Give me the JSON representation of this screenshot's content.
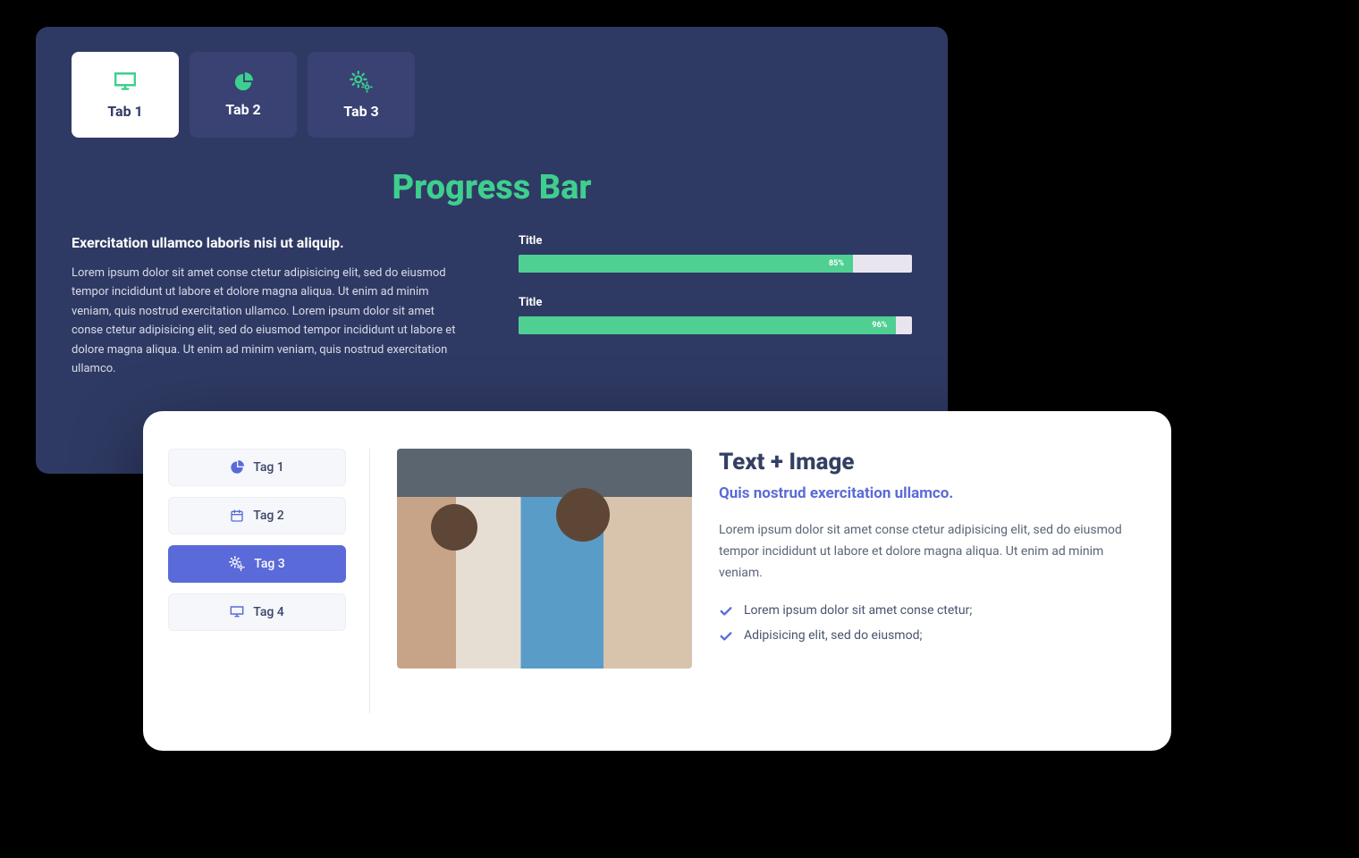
{
  "top": {
    "tabs": [
      {
        "label": "Tab 1",
        "icon": "desktop-icon",
        "active": true
      },
      {
        "label": "Tab 2",
        "icon": "pie-chart-icon",
        "active": false
      },
      {
        "label": "Tab 3",
        "icon": "gears-icon",
        "active": false
      }
    ],
    "section_title": "Progress Bar",
    "lead": "Exercitation ullamco laboris nisi ut aliquip.",
    "body": "Lorem ipsum dolor sit amet conse ctetur adipisicing elit, sed do eiusmod tempor incididunt ut labore et dolore magna aliqua. Ut enim ad minim veniam, quis nostrud exercitation ullamco. Lorem ipsum dolor sit amet conse ctetur adipisicing elit, sed do eiusmod tempor incididunt ut labore et dolore magna aliqua. Ut enim ad minim veniam, quis nostrud exercitation ullamco.",
    "bars": [
      {
        "title": "Title",
        "percent": 85,
        "label": "85%"
      },
      {
        "title": "Title",
        "percent": 96,
        "label": "96%"
      }
    ]
  },
  "bottom": {
    "tags": [
      {
        "label": "Tag 1",
        "icon": "pie-chart-icon",
        "active": false
      },
      {
        "label": "Tag 2",
        "icon": "calendar-icon",
        "active": false
      },
      {
        "label": "Tag 3",
        "icon": "gears-icon",
        "active": true
      },
      {
        "label": "Tag 4",
        "icon": "desktop-icon",
        "active": false
      }
    ],
    "title": "Text + Image",
    "subtitle": "Quis nostrud exercitation ullamco.",
    "body": "Lorem ipsum dolor sit amet conse ctetur adipisicing elit, sed do eiusmod tempor incididunt ut labore et dolore magna aliqua. Ut enim ad minim veniam.",
    "checks": [
      "Lorem ipsum dolor sit amet conse ctetur;",
      "Adipisicing elit, sed do eiusmod;"
    ]
  }
}
